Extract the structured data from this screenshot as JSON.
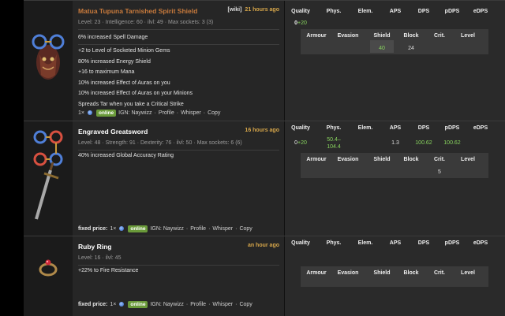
{
  "colors": {
    "background": "#000000",
    "panel": "#222222",
    "unique_name": "#c87a3c",
    "timestamp": "#d6a64a",
    "online_badge": "#6a9a3a",
    "positive_value": "#88d45e"
  },
  "stat_headers": [
    "Quality",
    "Phys.",
    "Elem.",
    "APS",
    "DPS",
    "pDPS",
    "eDPS"
  ],
  "sub_headers": [
    "Armour",
    "Evasion",
    "Shield",
    "Block",
    "Crit.",
    "Level"
  ],
  "items": [
    {
      "name": "Matua Tupuna Tarnished Spirit Shield",
      "wiki": "[wiki]",
      "time": "21 hours ago",
      "requirements": "Level: 23 · Intelligence: 60 · ilvl: 49 · Max sockets: 3 (3)",
      "implicit": "6% increased Spell Damage",
      "mods": [
        "+2 to Level of Socketed Minion Gems",
        "80% increased Energy Shield",
        "+16 to maximum Mana",
        "10% increased Effect of Auras on you",
        "10% increased Effect of Auras on your Minions",
        "Spreads Tar when you take a Critical Strike"
      ],
      "seller": {
        "fixed_price": "",
        "qty": "1×",
        "online": "online",
        "ign": "IGN: Naywizz",
        "links": [
          "Profile",
          "Whisper",
          "Copy"
        ]
      },
      "quality_base": "0",
      "quality_plus": "+20",
      "stats": {
        "phys": "",
        "elem": "",
        "aps": "",
        "dps": "",
        "pdps": "",
        "edps": ""
      },
      "sub": {
        "armour": "",
        "evasion": "",
        "shield": "40",
        "block": "24",
        "crit": "",
        "level": ""
      },
      "icon": "shield-icon"
    },
    {
      "name": "Engraved Greatsword",
      "wiki": "",
      "time": "16 hours ago",
      "requirements": "Level: 48 · Strength: 91 · Dexterity: 76 · ilvl: 50 · Max sockets: 6 (6)",
      "implicit": "40% increased Global Accuracy Rating",
      "mods": [],
      "seller": {
        "fixed_price": "fixed price:",
        "qty": "1×",
        "online": "online",
        "ign": "IGN: Naywizz",
        "links": [
          "Profile",
          "Whisper",
          "Copy"
        ]
      },
      "quality_base": "0",
      "quality_plus": "+20",
      "stats": {
        "phys": "50.4–104.4",
        "elem": "",
        "aps": "1.3",
        "dps": "100.62",
        "pdps": "100.62",
        "edps": ""
      },
      "sub": {
        "armour": "",
        "evasion": "",
        "shield": "",
        "block": "",
        "crit": "5",
        "level": ""
      },
      "icon": "greatsword-icon"
    },
    {
      "name": "Ruby Ring",
      "wiki": "",
      "time": "an hour ago",
      "requirements": "Level: 16 · ilvl: 45",
      "implicit": "+22% to Fire Resistance",
      "mods": [],
      "seller": {
        "fixed_price": "fixed price:",
        "qty": "1×",
        "online": "online",
        "ign": "IGN: Naywizz",
        "links": [
          "Profile",
          "Whisper",
          "Copy"
        ]
      },
      "quality_base": "",
      "quality_plus": "",
      "stats": {
        "phys": "",
        "elem": "",
        "aps": "",
        "dps": "",
        "pdps": "",
        "edps": ""
      },
      "sub": {
        "armour": "",
        "evasion": "",
        "shield": "",
        "block": "",
        "crit": "",
        "level": ""
      },
      "icon": "ring-icon"
    }
  ]
}
